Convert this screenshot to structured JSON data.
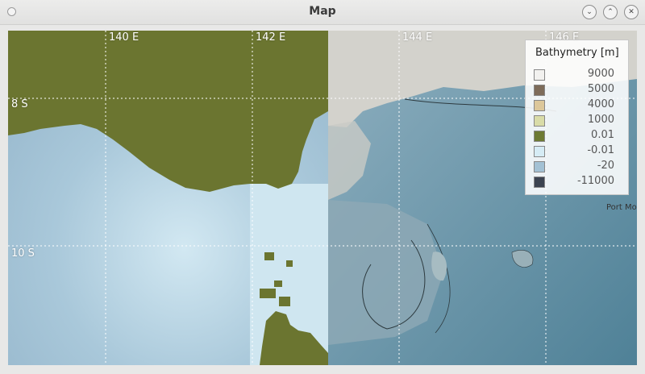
{
  "window": {
    "title": "Map",
    "buttons": [
      "minimize",
      "maximize",
      "close"
    ]
  },
  "map": {
    "grid_labels": {
      "lon": [
        "140 E",
        "142 E",
        "144 E",
        "146 E"
      ],
      "lat": [
        "8 S",
        "10 S"
      ]
    },
    "edge_place_label": "Port Mo",
    "colors": {
      "land": "#6b7530",
      "shallow": "#cfe6f0",
      "basemap_sea": "#7ea1b3",
      "basemap_land": "#d6d4cf"
    }
  },
  "legend": {
    "title": "Bathymetry [m]",
    "entries": [
      {
        "label": "9000",
        "color": "#f2f1ef"
      },
      {
        "label": "5000",
        "color": "#7e6c5a"
      },
      {
        "label": "4000",
        "color": "#dcc79a"
      },
      {
        "label": "1000",
        "color": "#d9dca8"
      },
      {
        "label": "0.01",
        "color": "#6d7a33"
      },
      {
        "label": "-0.01",
        "color": "#d6ecf5"
      },
      {
        "label": "-20",
        "color": "#a3c1d4"
      },
      {
        "label": "-11000",
        "color": "#3c4350"
      }
    ]
  }
}
